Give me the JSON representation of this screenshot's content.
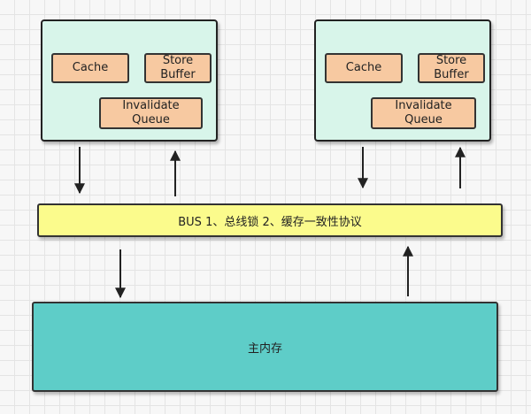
{
  "cpu_left": {
    "cache": "Cache",
    "store_buffer": "Store\nBuffer",
    "invalidate_queue": "Invalidate\nQueue"
  },
  "cpu_right": {
    "cache": "Cache",
    "store_buffer": "Store\nBuffer",
    "invalidate_queue": "Invalidate\nQueue"
  },
  "bus": {
    "label": "BUS 1、总线锁 2、缓存一致性协议"
  },
  "memory": {
    "label": "主内存"
  },
  "colors": {
    "cpu_fill": "#d8f5ea",
    "chip_fill": "#f7c9a1",
    "bus_fill": "#fbfb8c",
    "memory_fill": "#5ecdc8",
    "stroke": "#222222"
  }
}
